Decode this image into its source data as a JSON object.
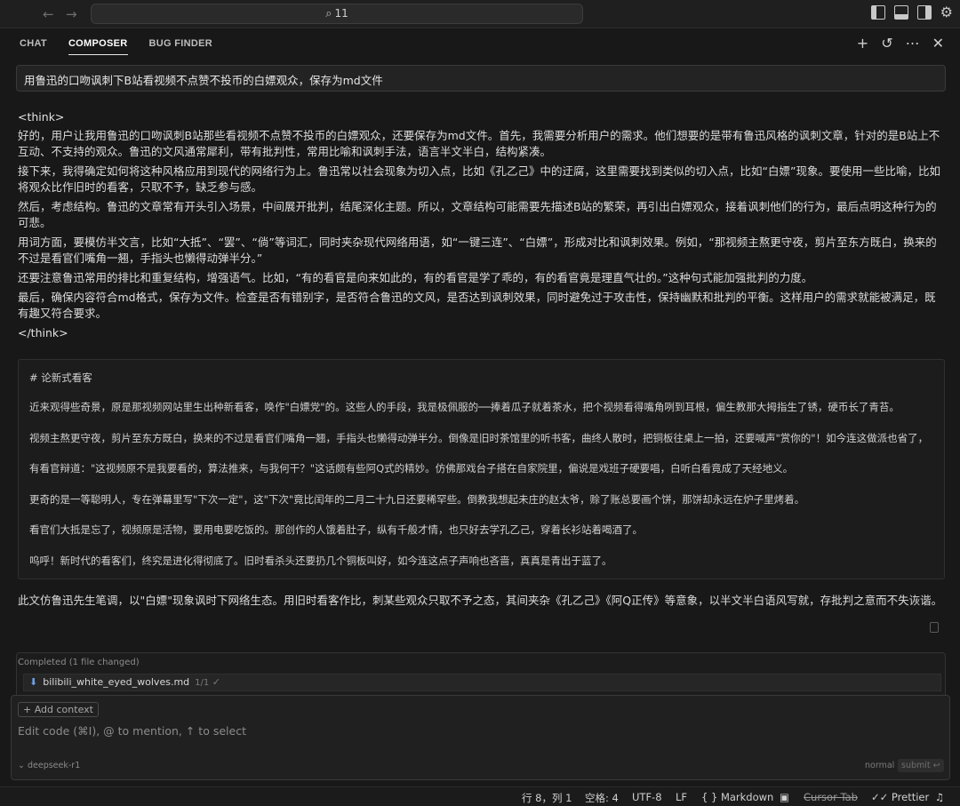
{
  "titlebar": {
    "search_text": "11"
  },
  "tabs": [
    {
      "label": "CHAT"
    },
    {
      "label": "COMPOSER"
    },
    {
      "label": "BUG FINDER"
    }
  ],
  "prompt": "用鲁迅的口吻讽刺下B站看视频不点赞不投币的白嫖观众，保存为md文件",
  "think_open": "<think>",
  "think_close": "</think>",
  "think_paragraphs": [
    "好的，用户让我用鲁迅的口吻讽刺B站那些看视频不点赞不投币的白嫖观众，还要保存为md文件。首先，我需要分析用户的需求。他们想要的是带有鲁迅风格的讽刺文章，针对的是B站上不互动、不支持的观众。鲁迅的文风通常犀利，带有批判性，常用比喻和讽刺手法，语言半文半白，结构紧凑。",
    "接下来，我得确定如何将这种风格应用到现代的网络行为上。鲁迅常以社会现象为切入点，比如《孔乙己》中的迂腐，这里需要找到类似的切入点，比如“白嫖”现象。要使用一些比喻，比如将观众比作旧时的看客，只取不予，缺乏参与感。",
    "然后，考虑结构。鲁迅的文章常有开头引入场景，中间展开批判，结尾深化主题。所以，文章结构可能需要先描述B站的繁荣，再引出白嫖观众，接着讽刺他们的行为，最后点明这种行为的可悲。",
    "用词方面，要模仿半文言，比如“大抵”、“罢”、“倘”等词汇，同时夹杂现代网络用语，如“一键三连”、“白嫖”，形成对比和讽刺效果。例如，“那视频主熬更守夜，剪片至东方既白，换来的不过是看官们嘴角一翘，手指头也懒得动弹半分。”",
    "还要注意鲁迅常用的排比和重复结构，增强语气。比如，“有的看官是向来如此的，有的看官是学了乖的，有的看官竟是理直气壮的。”这种句式能加强批判的力度。",
    "最后，确保内容符合md格式，保存为文件。检查是否有错别字，是否符合鲁迅的文风，是否达到讽刺效果，同时避免过于攻击性，保持幽默和批判的平衡。这样用户的需求就能被满足，既有趣又符合要求。"
  ],
  "markdown": {
    "title": "#  论新式看客",
    "lines": [
      "近来观得些奇景，原是那视频网站里生出种新看客，唤作\"白嫖党\"的。这些人的手段，我是极佩服的──捧着瓜子就着茶水，把个视频看得嘴角咧到耳根，偏生教那大拇指生了锈，硬币长了青苔。",
      "视频主熬更守夜，剪片至东方既白，换来的不过是看官们嘴角一翘，手指头也懒得动弹半分。倒像是旧时茶馆里的听书客，曲终人散时，把铜板往桌上一拍，还要喊声\"赏你的\"！如今连这做派也省了，",
      "有看官辩道：\"这视频原不是我要看的，算法推来，与我何干？\"这话颇有些阿Q式的精妙。仿佛那戏台子搭在自家院里，偏说是戏班子硬要唱，白听白看竟成了天经地义。",
      "更奇的是一等聪明人，专在弹幕里写\"下次一定\"，这\"下次\"竟比闰年的二月二十九日还要稀罕些。倒教我想起未庄的赵太爷，赊了账总要画个饼，那饼却永远在炉子里烤着。",
      "看官们大抵是忘了，视频原是活物，要用电要吃饭的。那创作的人饿着肚子，纵有千般才情，也只好去学孔乙己，穿着长衫站着喝酒了。",
      "呜呼！新时代的看客们，终究是进化得彻底了。旧时看杀头还要扔几个铜板叫好，如今连这点子声响也吝啬，真真是青出于蓝了。"
    ]
  },
  "summary": "此文仿鲁迅先生笔调，以\"白嫖\"现象讽时下网络生态。用旧时看客作比，刺某些观众只取不予之态，其间夹杂《孔乙己》《阿Q正传》等意象，以半文半白语风写就，存批判之意而不失诙谐。",
  "completed": {
    "header": "Completed  (1 file changed)",
    "file_name": "bilibili_white_eyed_wolves.md",
    "file_count": "1/1",
    "check": "✓"
  },
  "input": {
    "add_context": "+ Add context",
    "placeholder": "Edit code (⌘I), @ to mention, ↑ to select",
    "model": "deepseek-r1",
    "mode": "normal",
    "submit": "submit ↩"
  },
  "statusbar": {
    "position": "行 8，列 1",
    "spaces": "空格: 4",
    "encoding": "UTF-8",
    "eol": "LF",
    "language": "{ } Markdown",
    "cursor_tab": "Cursor Tab",
    "prettier": "✓✓ Prettier"
  }
}
